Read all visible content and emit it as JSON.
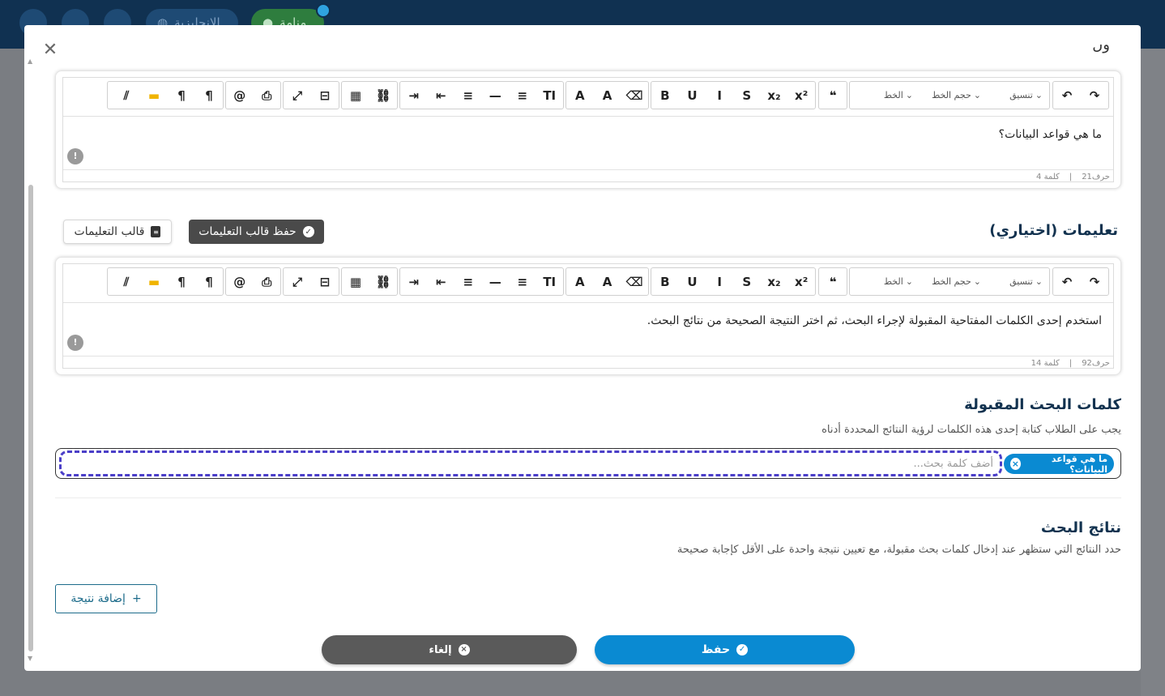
{
  "app": {
    "lang_pill": "الانجليزية",
    "status_pill": "منامة"
  },
  "modal": {
    "close_glyph": "✕",
    "cut_title": "ول"
  },
  "toolbar": {
    "font_label": "الخط",
    "font_size_label": "حجم الخط",
    "format_label": "تنسيق",
    "buttons": [
      "↷",
      "↶",
      "❝",
      "x²",
      "x₂",
      "S",
      "I",
      "U",
      "B",
      "⌫",
      "A",
      "A",
      "TI",
      "≡",
      "—",
      "≡",
      "⇤",
      "⇥",
      "⛓",
      "▦",
      "⊟",
      "⤢",
      "⎙",
      "@",
      "¶",
      "¶",
      "▬",
      "⫽"
    ]
  },
  "question_editor": {
    "text": "ما هي قواعد البيانات؟",
    "chars_label": "حرف21",
    "words_label": "كلمة 4"
  },
  "instructions": {
    "heading": "تعليمات (اختياري)",
    "save_template_label": "حفظ قالب التعليمات",
    "template_label": "قالب التعليمات",
    "text": "استخدم إحدى الكلمات المفتاحية المقبولة لإجراء البحث، ثم اختر النتيجة الصحيحة من نتائج البحث.",
    "chars_label": "حرف92",
    "words_label": "كلمة 14"
  },
  "keywords": {
    "heading": "كلمات البحث المقبولة",
    "subtitle": "يجب على الطلاب كتابة إحدى هذه الكلمات لرؤية النتائج المحددة أدناه",
    "chip": "ما هي قواعد البيانات؟",
    "placeholder": "أضف كلمة بحث..."
  },
  "results": {
    "heading": "نتائج البحث",
    "subtitle": "حدد النتائج التي ستظهر عند إدخال كلمات بحث مقبولة، مع تعيين نتيجة واحدة على الأقل كإجابة صحيحة",
    "add_label": "إضافة نتيجة"
  },
  "footer": {
    "cancel_label": "إلغاء",
    "save_label": "حفظ"
  },
  "colors": {
    "primary": "#0a8ad2",
    "dark_button": "#4a4a4a",
    "heading": "#12324f",
    "dashed_focus": "#4b3fc8"
  }
}
